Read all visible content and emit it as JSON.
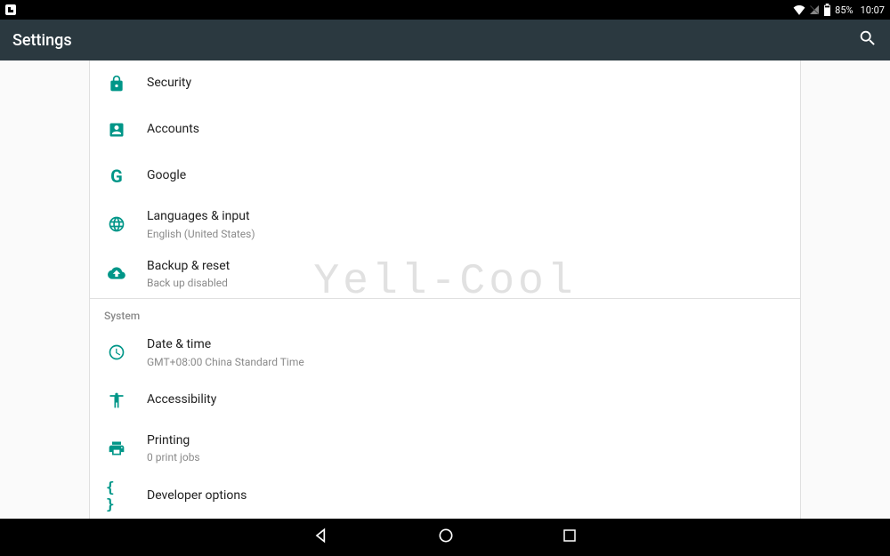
{
  "status": {
    "battery_pct": "85%",
    "clock": "10:07"
  },
  "appbar": {
    "title": "Settings"
  },
  "personal": {
    "security": "Security",
    "accounts": "Accounts",
    "google": "Google",
    "languages": {
      "title": "Languages & input",
      "sub": "English (United States)"
    },
    "backup": {
      "title": "Backup & reset",
      "sub": "Back up disabled"
    }
  },
  "system": {
    "header": "System",
    "datetime": {
      "title": "Date & time",
      "sub": "GMT+08:00 China Standard Time"
    },
    "accessibility": "Accessibility",
    "printing": {
      "title": "Printing",
      "sub": "0 print jobs"
    },
    "developer": "Developer options"
  },
  "watermark": "Yell-Cool"
}
